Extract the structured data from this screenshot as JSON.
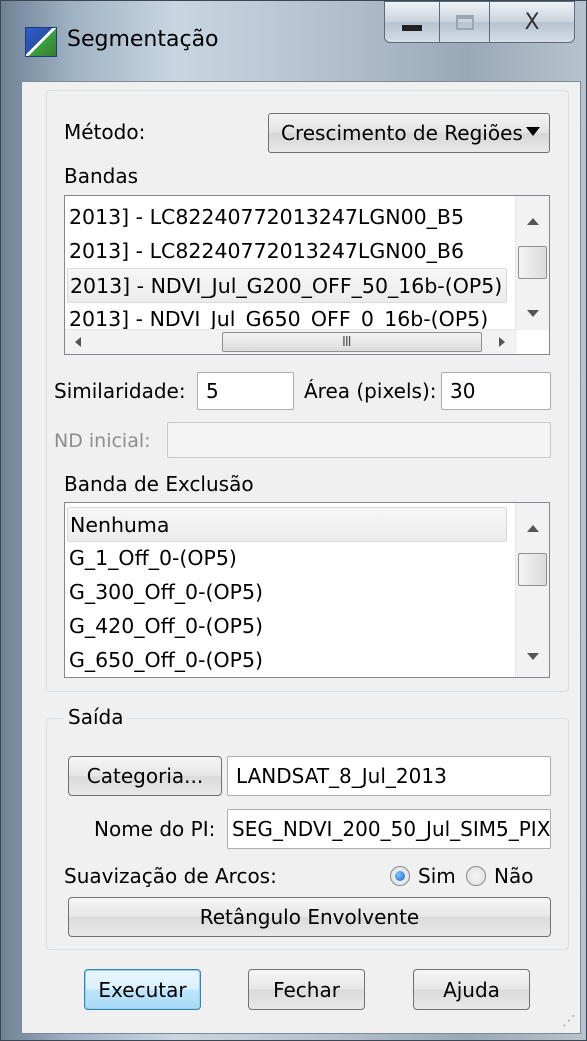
{
  "window": {
    "title": "Segmentação",
    "icon": "segmentation-app-icon",
    "close_glyph": "X"
  },
  "method": {
    "label": "Método:",
    "selected": "Crescimento de Regiões"
  },
  "bands": {
    "label": "Bandas",
    "items": [
      "2013] - LC82240772013247LGN00_B5",
      "2013] - LC82240772013247LGN00_B6",
      "2013] - NDVI_Jul_G200_OFF_50_16b-(OP5)",
      "2013] - NDVI_Jul_G650_OFF_0_16b-(OP5)"
    ],
    "selected_index": 2,
    "hscroll_grip": "III"
  },
  "params": {
    "similarity_label": "Similaridade:",
    "similarity_value": "5",
    "area_label": "Área (pixels):",
    "area_value": "30",
    "nd_initial_label": "ND inicial:",
    "nd_initial_value": ""
  },
  "exclusion": {
    "label": "Banda de Exclusão",
    "items": [
      "Nenhuma",
      "G_1_Off_0-(OP5)",
      "G_300_Off_0-(OP5)",
      "G_420_Off_0-(OP5)",
      "G_650_Off_0-(OP5)"
    ],
    "selected_index": 0
  },
  "output": {
    "legend": "Saída",
    "category_button": "Categoria...",
    "category_value": "LANDSAT_8_Jul_2013",
    "pi_name_label": "Nome do PI:",
    "pi_name_value": "SEG_NDVI_200_50_Jul_SIM5_PIX",
    "smoothing_label": "Suavização de Arcos:",
    "yes_label": "Sim",
    "no_label": "Não",
    "smoothing_selected": "Sim",
    "bounding_rect_button": "Retângulo Envolvente"
  },
  "actions": {
    "execute": "Executar",
    "close": "Fechar",
    "help": "Ajuda"
  }
}
